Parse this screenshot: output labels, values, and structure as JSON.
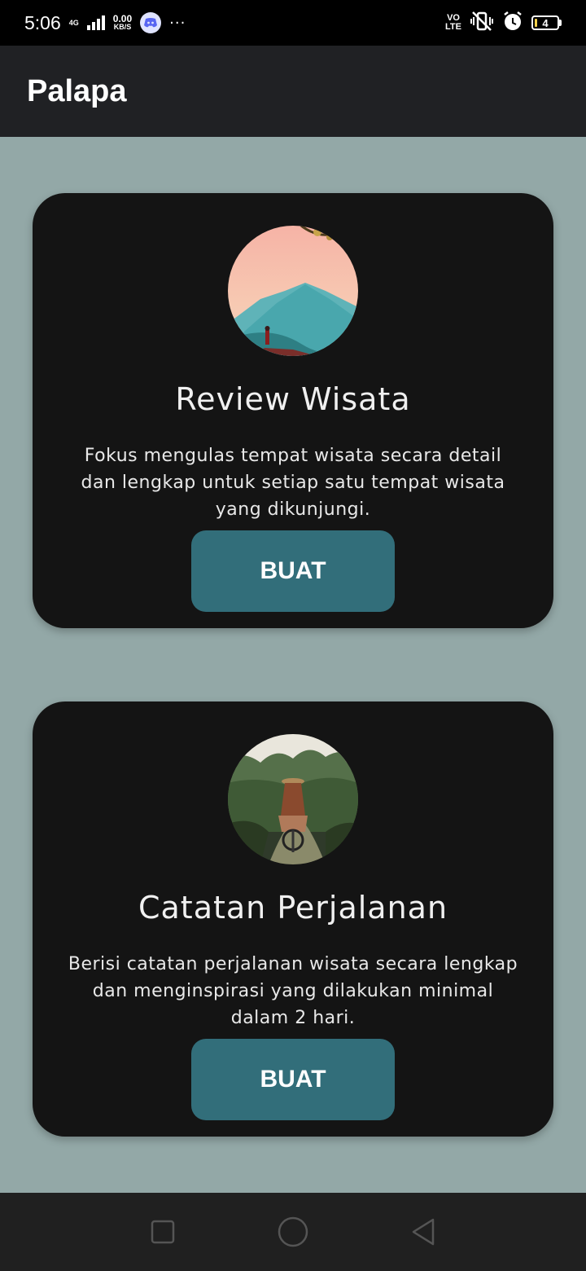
{
  "status_bar": {
    "time": "5:06",
    "network_type": "4G",
    "speed_value": "0.00",
    "speed_unit": "KB/S",
    "more_indicator": "···",
    "volte_top": "VO",
    "volte_bottom": "LTE",
    "battery_level": "4",
    "icons": [
      "signal-icon",
      "discord-icon",
      "vibrate-icon",
      "alarm-icon",
      "battery-icon"
    ]
  },
  "app_bar": {
    "title": "Palapa"
  },
  "cards": [
    {
      "title": "Review Wisata",
      "description": "Fokus mengulas tempat wisata secara detail dan lengkap untuk setiap satu tempat wisata yang dikunjungi.",
      "button_label": "BUAT",
      "image": "mountain-traveler-photo"
    },
    {
      "title": "Catatan Perjalanan",
      "description": "Berisi catatan perjalanan wisata secara lengkap dan menginspirasi yang dilakukan minimal dalam 2 hari.",
      "button_label": "BUAT",
      "image": "cyclist-field-photo"
    }
  ],
  "nav_bar": {
    "icons": [
      "recents-icon",
      "home-icon",
      "back-icon"
    ]
  },
  "colors": {
    "background": "#93a8a7",
    "card": "#141414",
    "button": "#326e7a",
    "app_bar": "#202124"
  }
}
